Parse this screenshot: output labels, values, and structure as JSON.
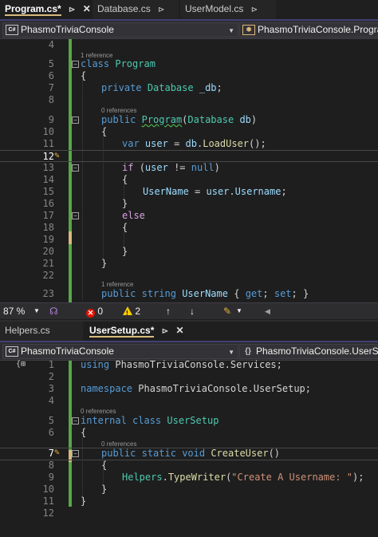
{
  "top_pane": {
    "tabs": [
      {
        "label": "Program.cs*",
        "active": true,
        "pin": "⊳",
        "close": "✕"
      },
      {
        "label": "Database.cs",
        "active": false,
        "pin": "⊳"
      },
      {
        "label": "UserModel.cs",
        "active": false,
        "pin": "⊳"
      }
    ],
    "nav_project": "PhasmoTriviaConsole",
    "nav_class": "PhasmoTriviaConsole.Program",
    "line_numbers": [
      "4",
      "5",
      "6",
      "7",
      "8",
      "9",
      "10",
      "11",
      "12",
      "13",
      "14",
      "15",
      "16",
      "17",
      "18",
      "19",
      "20",
      "21",
      "22",
      "23"
    ],
    "codelens": [
      "1 reference",
      "0 references",
      "1 reference"
    ],
    "code": {
      "l5": [
        "class",
        "Program"
      ],
      "l6": "{",
      "l7": [
        "private",
        "Database",
        "_db",
        ";"
      ],
      "l9": [
        "public",
        "Program",
        "(",
        "Database",
        "db",
        ")"
      ],
      "l10": "{",
      "l11": [
        "var",
        "user",
        "=",
        "db",
        ".",
        "LoadUser",
        "();"
      ],
      "l13": [
        "if",
        "(",
        "user",
        "!=",
        "null",
        ")"
      ],
      "l14": "{",
      "l15": [
        "UserName",
        "=",
        "user",
        ".",
        "Username",
        ";"
      ],
      "l16": "}",
      "l17": "else",
      "l18": "{",
      "l20": "}",
      "l21": "}",
      "l23": [
        "public",
        "string",
        "UserName",
        "{",
        "get",
        ";",
        "set",
        ";",
        "}"
      ]
    }
  },
  "status": {
    "zoom": "87 %",
    "errors": "0",
    "warnings": "2",
    "up_arrow": "↑",
    "down_arrow": "↓"
  },
  "bottom_pane": {
    "tabs": [
      {
        "label": "Helpers.cs",
        "active": false
      },
      {
        "label": "UserSetup.cs*",
        "active": true,
        "pin": "⊳",
        "close": "✕"
      }
    ],
    "nav_project": "PhasmoTriviaConsole",
    "nav_class": "PhasmoTriviaConsole.UserSetup",
    "line_numbers": [
      "1",
      "2",
      "3",
      "4",
      "5",
      "6",
      "7",
      "8",
      "9",
      "10",
      "11",
      "12"
    ],
    "codelens": [
      "0 references",
      "0 references"
    ],
    "code": {
      "l1": [
        "using",
        "PhasmoTriviaConsole.Services",
        ";"
      ],
      "l3": [
        "namespace",
        "PhasmoTriviaConsole.UserSetup",
        ";"
      ],
      "l5": [
        "internal",
        "class",
        "UserSetup"
      ],
      "l6": "{",
      "l7": [
        "public",
        "static",
        "void",
        "CreateUser",
        "()"
      ],
      "l8": "{",
      "l9": [
        "Helpers",
        ".",
        "TypeWriter",
        "(",
        "\"Create A Username: \"",
        ");"
      ],
      "l10": "}",
      "l11": "}"
    }
  },
  "colors": {
    "background": "#1e1e1e",
    "keyword": "#569cd6",
    "type": "#4ec9b0",
    "identifier": "#9cdcfe",
    "method": "#dcdcaa",
    "string": "#ce9178",
    "control": "#d8a0df",
    "change_bar": "#57a64a"
  }
}
